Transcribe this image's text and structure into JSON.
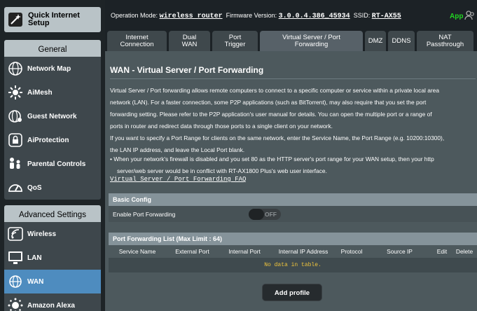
{
  "sidebar": {
    "quick_setup": "Quick Internet\nSetup",
    "general_header": "General",
    "general_items": [
      "Network Map",
      "AiMesh",
      "Guest Network",
      "AiProtection",
      "Parental Controls",
      "QoS"
    ],
    "advanced_header": "Advanced Settings",
    "advanced_items": [
      "Wireless",
      "LAN",
      "WAN",
      "Amazon Alexa"
    ],
    "active_item": "WAN"
  },
  "topbar": {
    "operation_mode_label": "Operation Mode:",
    "operation_mode": "wireless router",
    "firmware_label": "Firmware Version:",
    "firmware": "3.0.0.4.386_45934",
    "ssid_label": "SSID:",
    "ssid": "RT-AX55",
    "app_label": "App"
  },
  "tabs": [
    "Internet\nConnection",
    "Dual\nWAN",
    "Port\nTrigger",
    "Virtual Server / Port\nForwarding",
    "DMZ",
    "DDNS",
    "NAT\nPassthrough"
  ],
  "active_tab": "Virtual Server / Port\nForwarding",
  "page": {
    "title": "WAN - Virtual Server / Port Forwarding",
    "desc_lines": [
      "Virtual Server / Port forwarding allows remote computers to connect to a specific computer or service within a private local area",
      "network (LAN). For a faster connection, some P2P applications (such as BitTorrent), may also require that you set the port",
      "forwarding setting. Please refer to the P2P application's user manual for details. You can open the multiple port or a range of",
      "ports in router and redirect data through those ports to a single client on your network.",
      "If you want to specify a Port Range for clients on the same network, enter the Service Name, the Port Range (e.g. 10200:10300),",
      "the LAN IP address, and leave the Local Port blank."
    ],
    "bullet_lines": [
      "•  When your network's firewall is disabled and you set 80 as the HTTP server's port range for your WAN setup, then your http",
      "server/web server would be in conflict with RT-AX1800 Plus's web user interface."
    ],
    "faq_link": "Virtual Server / Port Forwarding FAQ",
    "basic_config": {
      "header": "Basic Config",
      "enable_label": "Enable Port Forwarding",
      "toggle_state": "OFF"
    },
    "list": {
      "header": "Port Forwarding List (Max Limit : 64)",
      "columns": [
        "Service Name",
        "External Port",
        "Internal Port",
        "Internal IP Address",
        "Protocol",
        "Source IP",
        "Edit",
        "Delete"
      ],
      "empty_text": "No data in table."
    },
    "add_button": "Add profile"
  },
  "colors": {
    "active_blue": "#4e8cbf",
    "app_green": "#22d622",
    "empty_yellow": "#f0c53c"
  }
}
